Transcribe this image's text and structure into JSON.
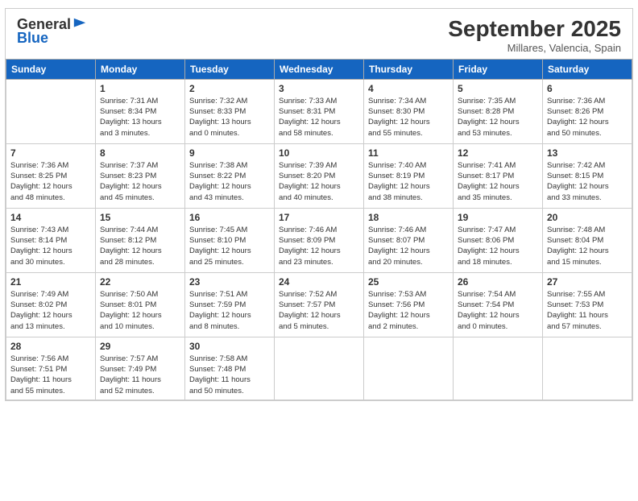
{
  "header": {
    "logo_general": "General",
    "logo_blue": "Blue",
    "month": "September 2025",
    "location": "Millares, Valencia, Spain"
  },
  "days_of_week": [
    "Sunday",
    "Monday",
    "Tuesday",
    "Wednesday",
    "Thursday",
    "Friday",
    "Saturday"
  ],
  "weeks": [
    [
      {
        "day": "",
        "text": ""
      },
      {
        "day": "1",
        "text": "Sunrise: 7:31 AM\nSunset: 8:34 PM\nDaylight: 13 hours\nand 3 minutes."
      },
      {
        "day": "2",
        "text": "Sunrise: 7:32 AM\nSunset: 8:33 PM\nDaylight: 13 hours\nand 0 minutes."
      },
      {
        "day": "3",
        "text": "Sunrise: 7:33 AM\nSunset: 8:31 PM\nDaylight: 12 hours\nand 58 minutes."
      },
      {
        "day": "4",
        "text": "Sunrise: 7:34 AM\nSunset: 8:30 PM\nDaylight: 12 hours\nand 55 minutes."
      },
      {
        "day": "5",
        "text": "Sunrise: 7:35 AM\nSunset: 8:28 PM\nDaylight: 12 hours\nand 53 minutes."
      },
      {
        "day": "6",
        "text": "Sunrise: 7:36 AM\nSunset: 8:26 PM\nDaylight: 12 hours\nand 50 minutes."
      }
    ],
    [
      {
        "day": "7",
        "text": "Sunrise: 7:36 AM\nSunset: 8:25 PM\nDaylight: 12 hours\nand 48 minutes."
      },
      {
        "day": "8",
        "text": "Sunrise: 7:37 AM\nSunset: 8:23 PM\nDaylight: 12 hours\nand 45 minutes."
      },
      {
        "day": "9",
        "text": "Sunrise: 7:38 AM\nSunset: 8:22 PM\nDaylight: 12 hours\nand 43 minutes."
      },
      {
        "day": "10",
        "text": "Sunrise: 7:39 AM\nSunset: 8:20 PM\nDaylight: 12 hours\nand 40 minutes."
      },
      {
        "day": "11",
        "text": "Sunrise: 7:40 AM\nSunset: 8:19 PM\nDaylight: 12 hours\nand 38 minutes."
      },
      {
        "day": "12",
        "text": "Sunrise: 7:41 AM\nSunset: 8:17 PM\nDaylight: 12 hours\nand 35 minutes."
      },
      {
        "day": "13",
        "text": "Sunrise: 7:42 AM\nSunset: 8:15 PM\nDaylight: 12 hours\nand 33 minutes."
      }
    ],
    [
      {
        "day": "14",
        "text": "Sunrise: 7:43 AM\nSunset: 8:14 PM\nDaylight: 12 hours\nand 30 minutes."
      },
      {
        "day": "15",
        "text": "Sunrise: 7:44 AM\nSunset: 8:12 PM\nDaylight: 12 hours\nand 28 minutes."
      },
      {
        "day": "16",
        "text": "Sunrise: 7:45 AM\nSunset: 8:10 PM\nDaylight: 12 hours\nand 25 minutes."
      },
      {
        "day": "17",
        "text": "Sunrise: 7:46 AM\nSunset: 8:09 PM\nDaylight: 12 hours\nand 23 minutes."
      },
      {
        "day": "18",
        "text": "Sunrise: 7:46 AM\nSunset: 8:07 PM\nDaylight: 12 hours\nand 20 minutes."
      },
      {
        "day": "19",
        "text": "Sunrise: 7:47 AM\nSunset: 8:06 PM\nDaylight: 12 hours\nand 18 minutes."
      },
      {
        "day": "20",
        "text": "Sunrise: 7:48 AM\nSunset: 8:04 PM\nDaylight: 12 hours\nand 15 minutes."
      }
    ],
    [
      {
        "day": "21",
        "text": "Sunrise: 7:49 AM\nSunset: 8:02 PM\nDaylight: 12 hours\nand 13 minutes."
      },
      {
        "day": "22",
        "text": "Sunrise: 7:50 AM\nSunset: 8:01 PM\nDaylight: 12 hours\nand 10 minutes."
      },
      {
        "day": "23",
        "text": "Sunrise: 7:51 AM\nSunset: 7:59 PM\nDaylight: 12 hours\nand 8 minutes."
      },
      {
        "day": "24",
        "text": "Sunrise: 7:52 AM\nSunset: 7:57 PM\nDaylight: 12 hours\nand 5 minutes."
      },
      {
        "day": "25",
        "text": "Sunrise: 7:53 AM\nSunset: 7:56 PM\nDaylight: 12 hours\nand 2 minutes."
      },
      {
        "day": "26",
        "text": "Sunrise: 7:54 AM\nSunset: 7:54 PM\nDaylight: 12 hours\nand 0 minutes."
      },
      {
        "day": "27",
        "text": "Sunrise: 7:55 AM\nSunset: 7:53 PM\nDaylight: 11 hours\nand 57 minutes."
      }
    ],
    [
      {
        "day": "28",
        "text": "Sunrise: 7:56 AM\nSunset: 7:51 PM\nDaylight: 11 hours\nand 55 minutes."
      },
      {
        "day": "29",
        "text": "Sunrise: 7:57 AM\nSunset: 7:49 PM\nDaylight: 11 hours\nand 52 minutes."
      },
      {
        "day": "30",
        "text": "Sunrise: 7:58 AM\nSunset: 7:48 PM\nDaylight: 11 hours\nand 50 minutes."
      },
      {
        "day": "",
        "text": ""
      },
      {
        "day": "",
        "text": ""
      },
      {
        "day": "",
        "text": ""
      },
      {
        "day": "",
        "text": ""
      }
    ]
  ]
}
